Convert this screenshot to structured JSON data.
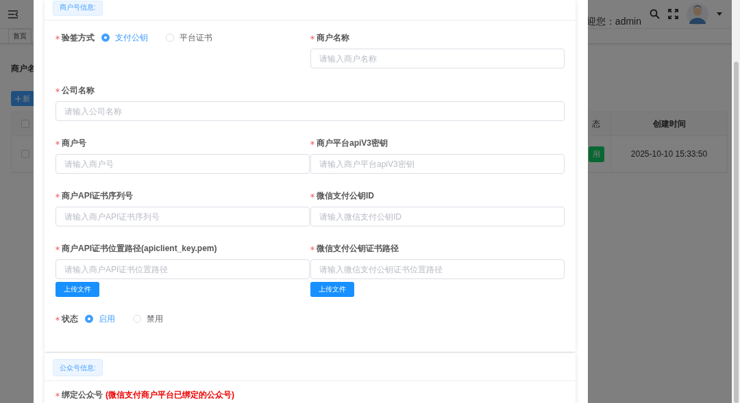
{
  "header": {
    "greeting": "迎您：admin"
  },
  "tabs_bar": {
    "tab": "首页"
  },
  "search_label": "商户名",
  "add_button": {
    "label": "新"
  },
  "table": {
    "select_all_checked": false,
    "columns": [
      "态",
      "创建时间"
    ],
    "rows": [
      {
        "checked": false,
        "status": "用",
        "created": "2025-10-10 15:33:50"
      }
    ]
  },
  "dialog": {
    "sections": [
      {
        "title": "商户号信息:",
        "fields": [
          {
            "kind": "radio",
            "label": "验签方式",
            "required": true,
            "options": [
              {
                "label": "支付公钥",
                "selected": true
              },
              {
                "label": "平台证书",
                "selected": false
              }
            ]
          },
          {
            "kind": "input",
            "label": "商户名称",
            "required": true,
            "placeholder": "请输入商户名称"
          },
          {
            "kind": "input",
            "label": "公司名称",
            "required": true,
            "wide": true,
            "placeholder": "请输入公司名称"
          },
          {
            "kind": "input",
            "label": "商户号",
            "required": true,
            "placeholder": "请输入商户号"
          },
          {
            "kind": "input",
            "label": "商户平台apiV3密钥",
            "required": true,
            "placeholder": "请输入商户平台apiV3密钥"
          },
          {
            "kind": "input",
            "label": "商户API证书序列号",
            "required": true,
            "placeholder": "请输入商户API证书序列号"
          },
          {
            "kind": "input",
            "label": "微信支付公钥ID",
            "required": true,
            "placeholder": "请输入微信支付公钥ID"
          },
          {
            "kind": "upload",
            "label": "商户API证书位置路径(apiclient_key.pem)",
            "required": true,
            "placeholder": "请输入商户API证书位置路径",
            "button": "上传文件"
          },
          {
            "kind": "upload",
            "label": "微信支付公钥证书路径",
            "required": true,
            "placeholder": "请输入微信支付公钥证书位置路径",
            "button": "上传文件"
          },
          {
            "kind": "radio",
            "label": "状态",
            "required": true,
            "options": [
              {
                "label": "启用",
                "selected": true
              },
              {
                "label": "禁用",
                "selected": false
              }
            ]
          }
        ]
      },
      {
        "title": "公众号信息:",
        "fields": [
          {
            "kind": "note",
            "label": "绑定公众号",
            "required": true,
            "note": "(微信支付商户平台已绑定的公众号)"
          }
        ]
      }
    ]
  }
}
